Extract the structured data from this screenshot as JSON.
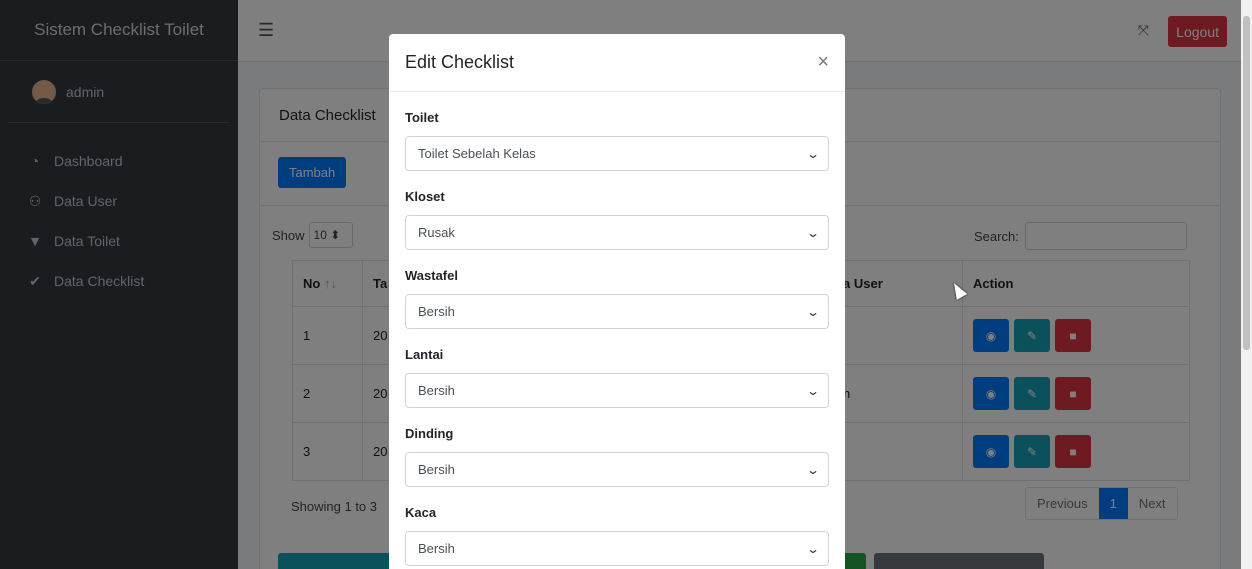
{
  "sidebar": {
    "brand": "Sistem Checklist Toilet",
    "user": "admin",
    "items": [
      {
        "label": "Dashboard",
        "icon": "tachometer-icon"
      },
      {
        "label": "Data User",
        "icon": "users-icon"
      },
      {
        "label": "Data Toilet",
        "icon": "toilet-icon"
      },
      {
        "label": "Data Checklist",
        "icon": "check-icon"
      }
    ]
  },
  "header": {
    "logout_label": "Logout"
  },
  "card": {
    "title": "Data Checklist",
    "add_label": "Tambah",
    "show_label": "Show",
    "show_value": "10",
    "search_label": "Search:",
    "columns": [
      "No",
      "Ta",
      "a User",
      "Action"
    ],
    "rows": [
      {
        "no": "1",
        "ta": "20",
        "user": ""
      },
      {
        "no": "2",
        "ta": "20",
        "user": "h"
      },
      {
        "no": "3",
        "ta": "20",
        "user": ""
      }
    ],
    "showing": "Showing 1 to 3",
    "pager": {
      "prev": "Previous",
      "page": "1",
      "next": "Next"
    }
  },
  "modal": {
    "title": "Edit Checklist",
    "fields": [
      {
        "label": "Toilet",
        "value": "Toilet Sebelah Kelas"
      },
      {
        "label": "Kloset",
        "value": "Rusak"
      },
      {
        "label": "Wastafel",
        "value": "Bersih"
      },
      {
        "label": "Lantai",
        "value": "Bersih"
      },
      {
        "label": "Dinding",
        "value": "Bersih"
      },
      {
        "label": "Kaca",
        "value": "Bersih"
      }
    ]
  },
  "colors": {
    "primary": "#007bff",
    "danger": "#dc3545",
    "info": "#17a2b8",
    "sidebar": "#343a40"
  }
}
